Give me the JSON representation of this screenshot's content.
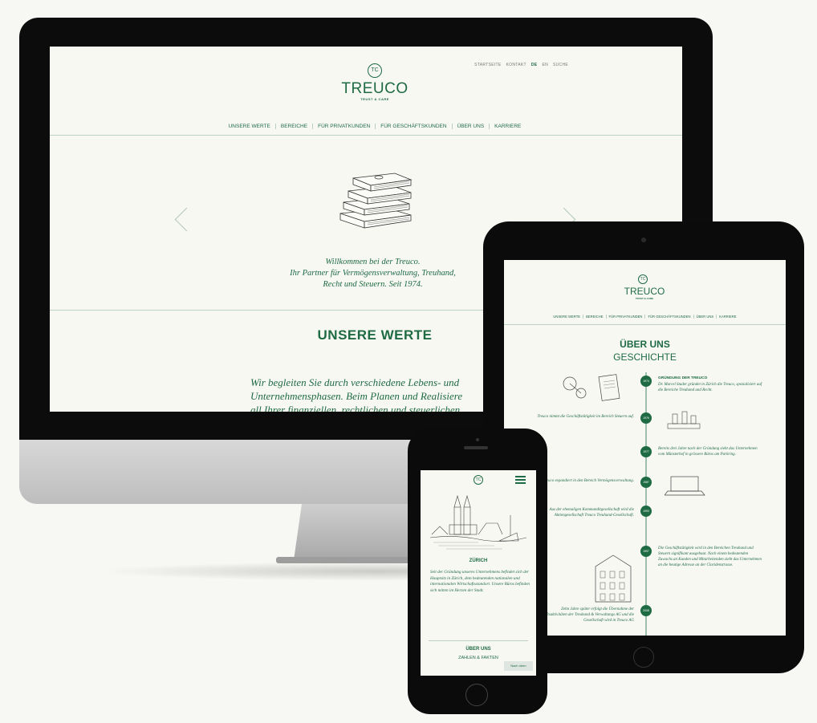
{
  "desktop": {
    "top_links": [
      "STARTSEITE",
      "KONTAKT",
      "DE",
      "EN",
      "SUCHE"
    ],
    "brand": "TREUCO",
    "brand_sub": "TRUST & CARE",
    "nav": [
      "UNSERE WERTE",
      "BEREICHE",
      "FÜR PRIVATKUNDEN",
      "FÜR GESCHÄFTSKUNDEN",
      "ÜBER UNS",
      "KARRIERE"
    ],
    "welcome_lines": [
      "Willkommen bei der Treuco.",
      "Ihr Partner für Vermögensverwaltung, Treuhand,",
      "Recht und Steuern. Seit 1974."
    ],
    "section_title": "UNSERE WERTE",
    "body_lines": [
      "Wir begleiten Sie durch verschiedene Lebens- und",
      "Unternehmensphasen. Beim Planen und Realisiere",
      "all Ihrer finanziellen, rechtlichen und steuerlichen"
    ]
  },
  "tablet": {
    "brand": "TREUCO",
    "brand_sub": "TRUST & CARE",
    "nav": [
      "UNSERE WERTE",
      "BEREICHE",
      "FÜR PRIVATKUNDEN",
      "FÜR GESCHÄFTSKUNDEN",
      "ÜBER UNS",
      "KARRIERE"
    ],
    "title": "ÜBER UNS",
    "subtitle": "GESCHICHTE",
    "timeline": [
      {
        "year": "1974",
        "side": "right",
        "heading": "GRÜNDUNG DER TREUCO",
        "text": "Dr. Marcel Studer gründet in Zürich die Treuco, spezialisiert auf die Bereiche Treuhand und Recht."
      },
      {
        "year": "1976",
        "side": "left",
        "heading": "",
        "text": "Treuco nimmt die Geschäftstätigkeit im Bereich Steuern auf."
      },
      {
        "year": "1977",
        "side": "right",
        "heading": "",
        "text": "Bereits drei Jahre nach der Gründung zieht das Unternehmen vom Münsterhof in grössere Büros am Parkring."
      },
      {
        "year": "1987",
        "side": "left",
        "heading": "",
        "text": "Treuco expandiert in den Bereich Vermögensverwaltung."
      },
      {
        "year": "1993",
        "side": "left",
        "heading": "",
        "text": "Aus der ehemaligen Kommanditgesellschaft wird die Aktiengesellschaft Treuco Treuhand-Gesellschaft."
      },
      {
        "year": "1997",
        "side": "right",
        "heading": "",
        "text": "Die Geschäftstätigkeit wird in den Bereichen Treuhand und Steuern signifikant ausgebaut. Nach einem bedeutenden Zuwachs an Kunden und Mitarbeitenden zieht das Unternehmen an die heutige Adresse an der Claridenstrasse."
      },
      {
        "year": "2008",
        "side": "left",
        "heading": "",
        "text": "Zehn Jahre später erfolgt die Übernahme der Geschäftsaktivitäten der Treuhand & Verwaltungs AG und die Gesellschaft wird in Treuco AG"
      }
    ]
  },
  "phone": {
    "section_title": "ZÜRICH",
    "body": "Seit der Gründung unseres Unternehmens befindet sich der Hauptsitz in Zürich, dem bedeutenden nationalen und internationalen Wirtschaftsstandort. Unsere Büros befinden sich mitten im Herzen der Stadt.",
    "next_title": "ÜBER UNS",
    "next_sub": "ZAHLEN & FAKTEN",
    "button_label": "Nach oben"
  }
}
